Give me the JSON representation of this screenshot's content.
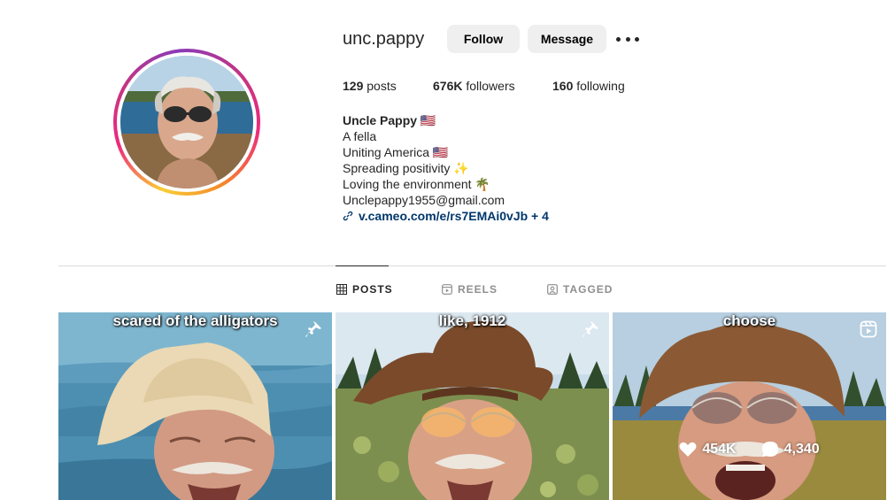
{
  "profile": {
    "username": "unc.pappy",
    "follow_label": "Follow",
    "message_label": "Message",
    "more_icon": "more-dots-icon"
  },
  "stats": {
    "posts_count": "129",
    "posts_label": "posts",
    "followers_count": "676K",
    "followers_label": "followers",
    "following_count": "160",
    "following_label": "following"
  },
  "bio": {
    "name": "Uncle Pappy 🇺🇸",
    "lines": [
      "A fella",
      "Uniting America 🇺🇸",
      "Spreading positivity ✨",
      "Loving the environment 🌴",
      "Unclepappy1955@gmail.com"
    ],
    "link": "v.cameo.com/e/rs7EMAi0vJb + 4"
  },
  "tabs": [
    {
      "label": "POSTS",
      "icon": "grid-icon",
      "active": true
    },
    {
      "label": "REELS",
      "icon": "reels-icon",
      "active": false
    },
    {
      "label": "TAGGED",
      "icon": "tagged-icon",
      "active": false
    }
  ],
  "posts": [
    {
      "caption": "scared of the alligators",
      "badge": "pin-icon"
    },
    {
      "caption": "like, 1912",
      "badge": "pin-icon"
    },
    {
      "caption": "choose",
      "badge": "reel-icon",
      "likes": "454K",
      "comments": "4,340"
    }
  ],
  "colors": {
    "button_bg": "#efefef",
    "link": "#00376b",
    "muted": "#8e8e8e",
    "divider": "#dbdbdb"
  }
}
